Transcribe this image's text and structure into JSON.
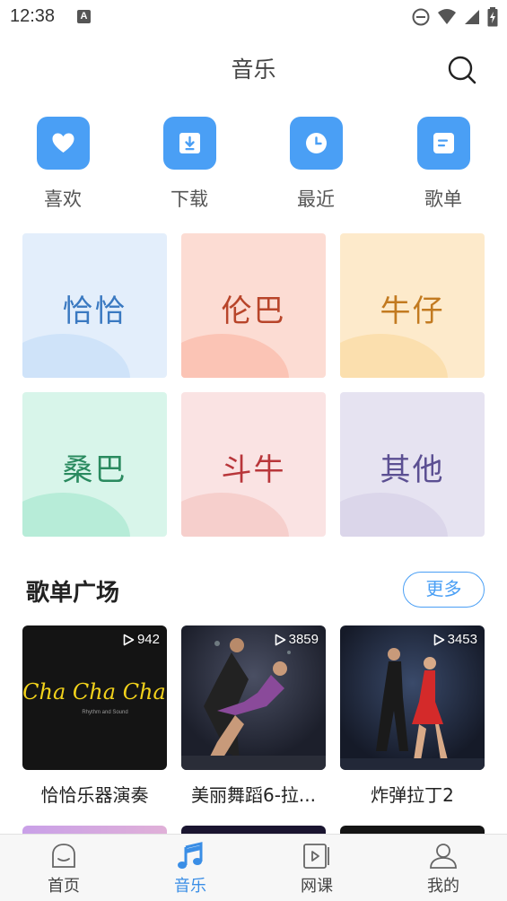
{
  "status": {
    "time": "12:38",
    "a_badge": "A"
  },
  "header": {
    "title": "音乐"
  },
  "quick": [
    {
      "label": "喜欢",
      "icon": "heart-icon"
    },
    {
      "label": "下载",
      "icon": "download-icon"
    },
    {
      "label": "最近",
      "icon": "clock-icon"
    },
    {
      "label": "歌单",
      "icon": "playlist-icon"
    }
  ],
  "dances": [
    {
      "name": "恰恰",
      "bg": "#e3eefb",
      "blob": "#cfe3f9",
      "color": "#3a79c1"
    },
    {
      "name": "伦巴",
      "bg": "#fcdcd3",
      "blob": "#fbc4b5",
      "color": "#b8452a"
    },
    {
      "name": "牛仔",
      "bg": "#fdeacb",
      "blob": "#fbdfae",
      "color": "#c27a20"
    },
    {
      "name": "桑巴",
      "bg": "#d8f5ea",
      "blob": "#b7ecd8",
      "color": "#2a8a5f"
    },
    {
      "name": "斗牛",
      "bg": "#fae3e3",
      "blob": "#f6cfcc",
      "color": "#b8363a"
    },
    {
      "name": "其他",
      "bg": "#e6e3f1",
      "blob": "#dbd6ea",
      "color": "#5b4f92"
    }
  ],
  "section": {
    "title": "歌单广场",
    "more": "更多"
  },
  "playlists": [
    {
      "title": "恰恰乐器演奏",
      "count": "942",
      "cover_text": "Cha Cha Cha",
      "cover_sub": "Rhythm and Sound"
    },
    {
      "title": "美丽舞蹈6-拉...",
      "count": "3859"
    },
    {
      "title": "炸弹拉丁2",
      "count": "3453"
    }
  ],
  "tabs": [
    {
      "label": "首页",
      "icon": "home-icon"
    },
    {
      "label": "音乐",
      "icon": "music-note-icon",
      "active": true
    },
    {
      "label": "网课",
      "icon": "video-icon"
    },
    {
      "label": "我的",
      "icon": "user-icon"
    }
  ],
  "colors": {
    "accent": "#4a9ff5",
    "active_tab": "#3a8ee6"
  }
}
